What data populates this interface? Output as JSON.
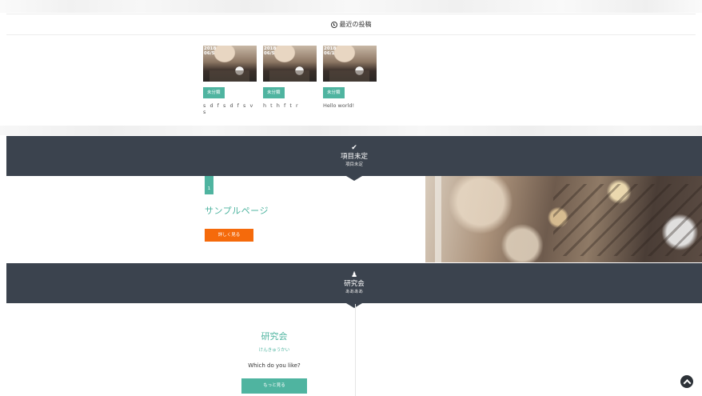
{
  "recent_posts": {
    "heading": "最近の投稿",
    "posts": [
      {
        "date": "2018\n06/5",
        "category": "未分類",
        "title": "s d f s d f s v s"
      },
      {
        "date": "2018\n06/5",
        "category": "未分類",
        "title": "h t h f t r"
      },
      {
        "date": "2018\n06/1",
        "category": "未分類",
        "title": "Hello world!"
      }
    ]
  },
  "section_pages": {
    "icon": "✔",
    "title": "項目未定",
    "subtitle": "項目未定"
  },
  "page_item": {
    "number": "1",
    "title": "サンプルページ",
    "button": "詳しく見る"
  },
  "section_lab": {
    "icon": "♟",
    "title": "研究会",
    "subtitle": "ああああ"
  },
  "lab_item": {
    "title": "研究会",
    "reading": "けんきゅうかい",
    "question": "Which do you like?",
    "button": "もっと見る"
  },
  "colors": {
    "accent": "#4fb4a0",
    "cta_orange": "#f56a0b",
    "section_dark": "#3b434e"
  },
  "icons": {
    "recent": "clock-icon",
    "section_pages": "check-icon",
    "section_lab": "person-icon",
    "back_to_top": "chevron-up-icon"
  }
}
